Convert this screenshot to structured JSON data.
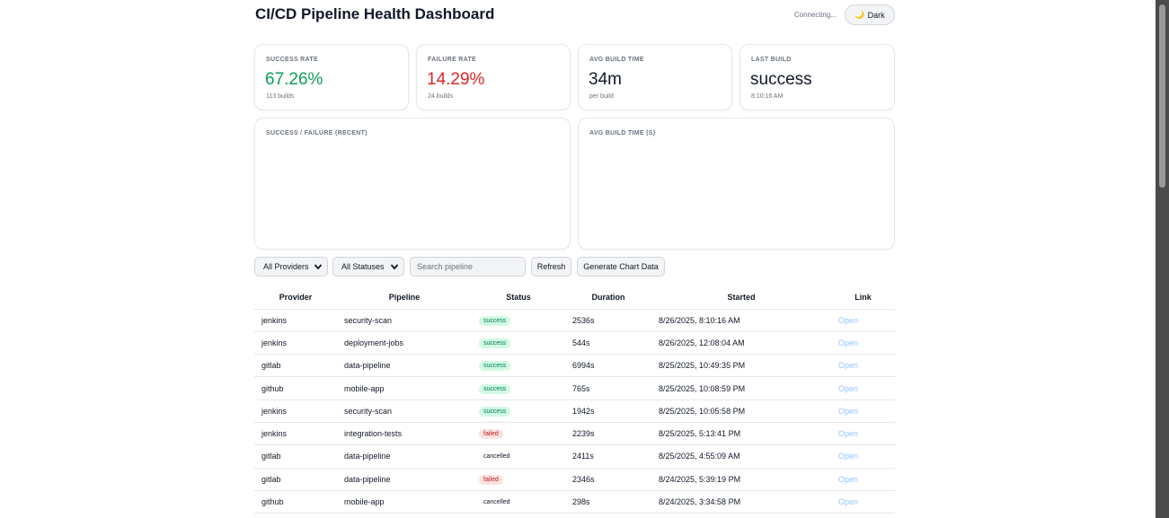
{
  "header": {
    "title": "CI/CD Pipeline Health Dashboard",
    "connection_status": "Connecting...",
    "theme_button": {
      "icon": "🌙",
      "label": "Dark"
    }
  },
  "stats": [
    {
      "label": "SUCCESS RATE",
      "value": "67.26%",
      "sub": "113 builds",
      "color": "#0f9d58"
    },
    {
      "label": "FAILURE RATE",
      "value": "14.29%",
      "sub": "24 builds",
      "color": "#e02424"
    },
    {
      "label": "AVG BUILD TIME",
      "value": "34m",
      "sub": "per build",
      "color": "#111827"
    },
    {
      "label": "LAST BUILD",
      "value": "success",
      "sub": "8:10:16 AM",
      "color": "#111827"
    }
  ],
  "charts": {
    "left_title": "SUCCESS / FAILURE (RECENT)",
    "right_title": "AVG BUILD TIME (S)"
  },
  "filters": {
    "provider_selected": "All Providers",
    "status_selected": "All Statuses",
    "search_placeholder": "Search pipeline",
    "refresh_label": "Refresh",
    "generate_label": "Generate Chart Data"
  },
  "table": {
    "headers": [
      "Provider",
      "Pipeline",
      "Status",
      "Duration",
      "Started",
      "Link"
    ],
    "rows": [
      {
        "provider": "jenkins",
        "pipeline": "security-scan",
        "status": "success",
        "duration": "2536s",
        "started": "8/26/2025, 8:10:16 AM",
        "link": "Open"
      },
      {
        "provider": "jenkins",
        "pipeline": "deployment-jobs",
        "status": "success",
        "duration": "544s",
        "started": "8/26/2025, 12:08:04 AM",
        "link": "Open"
      },
      {
        "provider": "gitlab",
        "pipeline": "data-pipeline",
        "status": "success",
        "duration": "6994s",
        "started": "8/25/2025, 10:49:35 PM",
        "link": "Open"
      },
      {
        "provider": "github",
        "pipeline": "mobile-app",
        "status": "success",
        "duration": "765s",
        "started": "8/25/2025, 10:08:59 PM",
        "link": "Open"
      },
      {
        "provider": "jenkins",
        "pipeline": "security-scan",
        "status": "success",
        "duration": "1942s",
        "started": "8/25/2025, 10:05:58 PM",
        "link": "Open"
      },
      {
        "provider": "jenkins",
        "pipeline": "integration-tests",
        "status": "failed",
        "duration": "2239s",
        "started": "8/25/2025, 5:13:41 PM",
        "link": "Open"
      },
      {
        "provider": "gitlab",
        "pipeline": "data-pipeline",
        "status": "cancelled",
        "duration": "2411s",
        "started": "8/25/2025, 4:55:09 AM",
        "link": "Open"
      },
      {
        "provider": "gitlab",
        "pipeline": "data-pipeline",
        "status": "failed",
        "duration": "2346s",
        "started": "8/24/2025, 5:39:19 PM",
        "link": "Open"
      },
      {
        "provider": "github",
        "pipeline": "mobile-app",
        "status": "cancelled",
        "duration": "298s",
        "started": "8/24/2025, 3:34:58 PM",
        "link": "Open"
      }
    ]
  },
  "colors": {
    "success_text": "#047857",
    "success_bg": "#d1fae5",
    "failed_text": "#b91c1c",
    "failed_bg": "#fee2e2",
    "link": "#93c5fd"
  }
}
